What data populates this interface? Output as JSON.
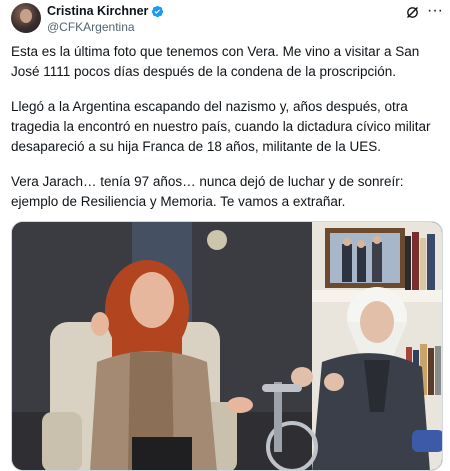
{
  "author": {
    "name": "Cristina Kirchner",
    "handle": "@CFKArgentina",
    "verified_icon": "verified-badge-icon",
    "verified_color": "#1d9bf0"
  },
  "actions": {
    "grok_icon": "grok-icon",
    "more_label": "···"
  },
  "tweet": {
    "paragraphs": [
      "Esta es la última foto que tenemos con Vera. Me vino a visitar a San José 1111 pocos días después de la condena de la proscripción.",
      "Llegó a la Argentina escapando del nazismo y, años después, otra tragedia la encontró en nuestro país, cuando la dictadura cívico militar desapareció a su hija Franca de 18 años, militante de la UES.",
      "Vera Jarach… tenía 97 años… nunca dejó de luchar y de sonreír: ejemplo de Resiliencia y Memoria. Te vamos a extrañar."
    ]
  },
  "media": {
    "type": "photo",
    "accent_text_color": "#0f1419",
    "secondary_text_color": "#536471"
  }
}
